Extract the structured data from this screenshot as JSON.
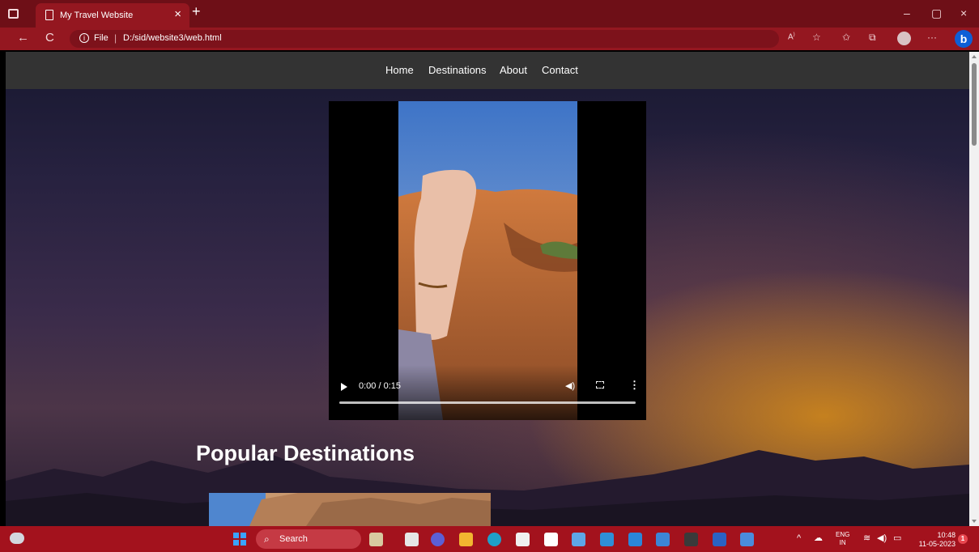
{
  "browser": {
    "tab_title": "My Travel Website",
    "tab_close": "×",
    "new_tab": "+",
    "url_scheme_label": "File",
    "url_separator": "|",
    "url_path": "D:/sid/website3/web.html",
    "bing_label": "b",
    "window_controls": {
      "minimize": "–",
      "restore": "▢",
      "close": "×"
    },
    "nav_back": "←",
    "nav_refresh": "C"
  },
  "nav": {
    "links": [
      "Home",
      "Destinations",
      "About",
      "Contact"
    ]
  },
  "video": {
    "time": "0:00 / 0:15",
    "progress_fraction": 0.0
  },
  "page": {
    "section_title": "Popular Destinations"
  },
  "taskbar": {
    "search_label": "Search",
    "lang_line1": "ENG",
    "lang_line2": "IN",
    "time": "10:48",
    "date": "11-05-2023",
    "notification_count": "1"
  },
  "colors": {
    "titlebar": "#6e0f17",
    "addressbar": "#941720",
    "navbar": "#333333",
    "taskbar": "#a3121d",
    "accent": "#0e5fd6"
  }
}
